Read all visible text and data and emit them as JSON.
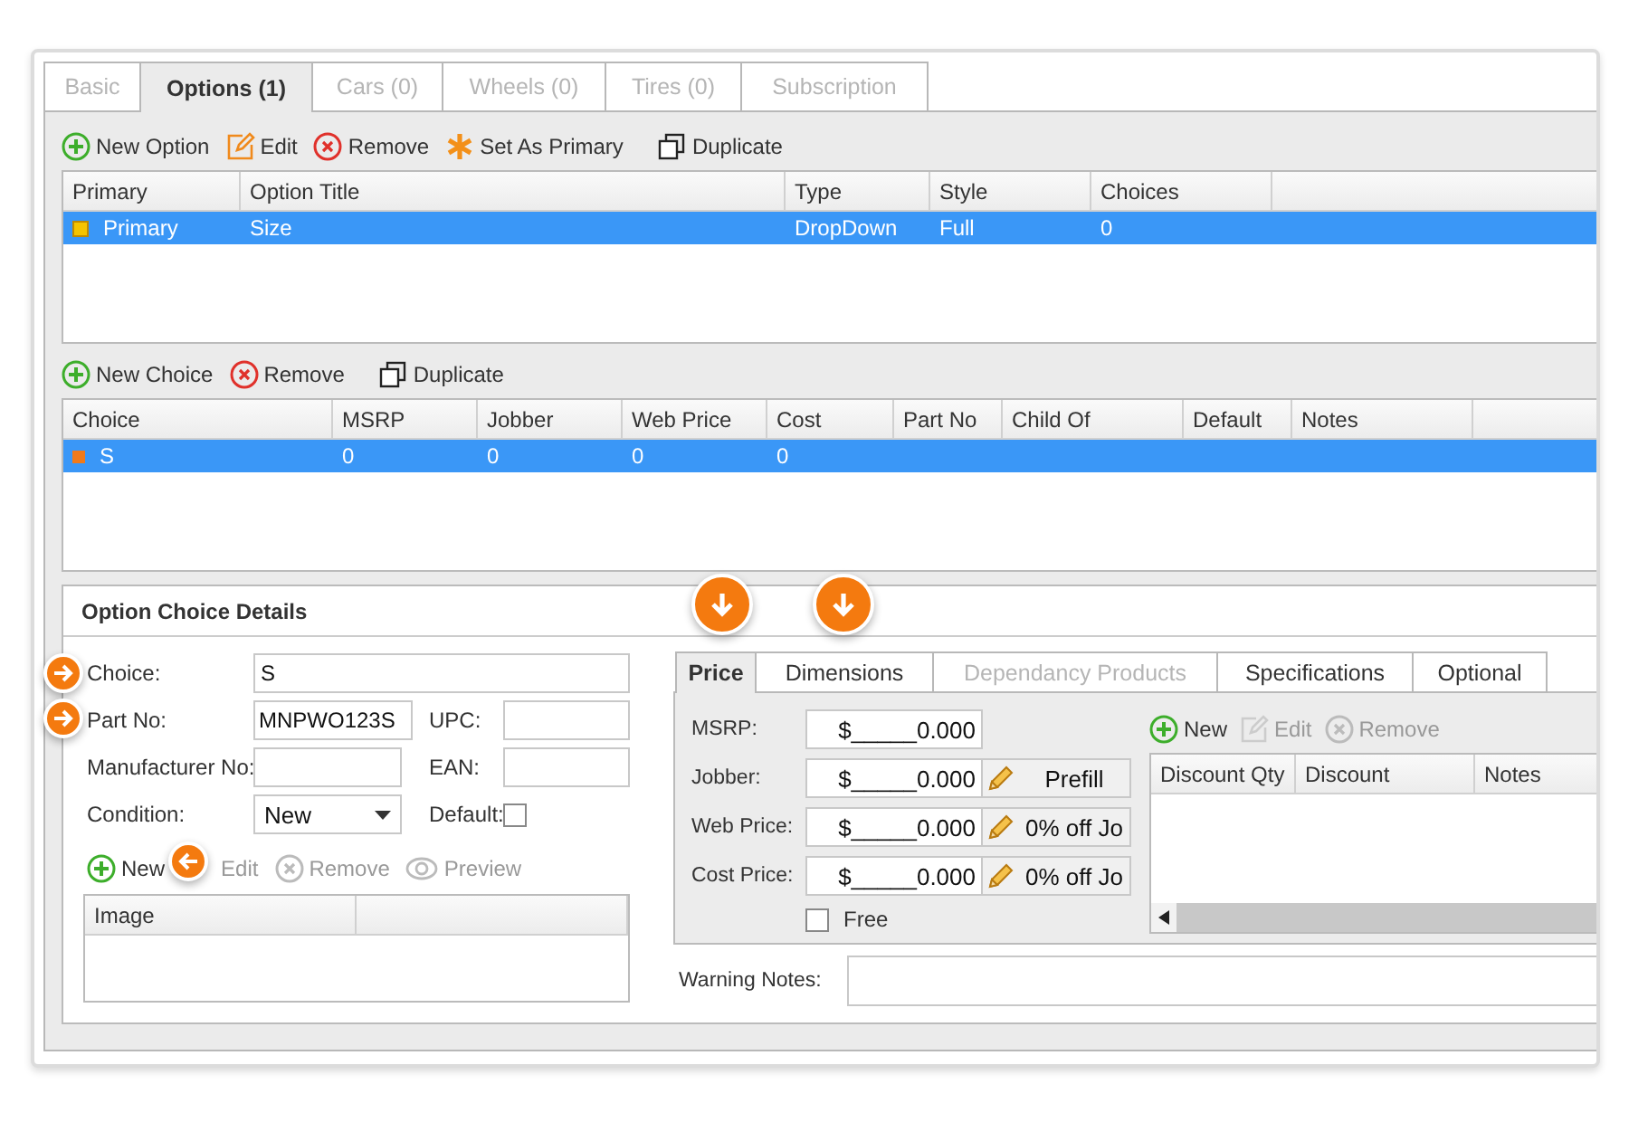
{
  "tabs": [
    {
      "label": "Basic",
      "selected": false,
      "disabled": true
    },
    {
      "label": "Options (1)",
      "selected": true,
      "disabled": false
    },
    {
      "label": "Cars (0)",
      "selected": false,
      "disabled": true
    },
    {
      "label": "Wheels (0)",
      "selected": false,
      "disabled": true
    },
    {
      "label": "Tires (0)",
      "selected": false,
      "disabled": true
    },
    {
      "label": "Subscription",
      "selected": false,
      "disabled": true
    }
  ],
  "option_toolbar": [
    {
      "label": "New Option",
      "kind": "add",
      "disabled": false
    },
    {
      "label": "Edit",
      "kind": "edit",
      "disabled": false
    },
    {
      "label": "Remove",
      "kind": "remove",
      "disabled": false
    },
    {
      "label": "Set As Primary",
      "kind": "star",
      "disabled": false
    },
    {
      "label": "Duplicate",
      "kind": "duplicate",
      "disabled": false
    }
  ],
  "options_table": {
    "columns": [
      "Primary",
      "Option Title",
      "Type",
      "Style",
      "Choices"
    ],
    "rows": [
      {
        "cells": [
          "Primary",
          "Size",
          "DropDown",
          "Full",
          "0"
        ],
        "selected": true
      }
    ]
  },
  "choice_toolbar": [
    {
      "label": "New Choice",
      "kind": "add",
      "disabled": false
    },
    {
      "label": "Remove",
      "kind": "remove",
      "disabled": false
    },
    {
      "label": "Duplicate",
      "kind": "duplicate",
      "disabled": false
    }
  ],
  "choices_table": {
    "columns": [
      "Choice",
      "MSRP",
      "Jobber",
      "Web Price",
      "Cost",
      "Part No",
      "Child Of",
      "Default",
      "Notes"
    ],
    "rows": [
      {
        "cells": [
          "S",
          "0",
          "0",
          "0",
          "0"
        ],
        "selected": true
      }
    ]
  },
  "details": {
    "title": "Option Choice Details",
    "choice": {
      "label": "Choice:",
      "value": "S"
    },
    "part_no": {
      "label": "Part No:",
      "value": "MNPWO123S"
    },
    "upc": {
      "label": "UPC:"
    },
    "manufacturer_no": {
      "label": "Manufacturer No:"
    },
    "ean": {
      "label": "EAN:"
    },
    "condition": {
      "label": "Condition:",
      "value": "New"
    },
    "default": {
      "label": "Default:",
      "checked": false
    },
    "image_toolbar": [
      {
        "label": "New",
        "kind": "add",
        "disabled": false
      },
      {
        "label": "Edit",
        "kind": "edit",
        "disabled": true
      },
      {
        "label": "Remove",
        "kind": "remove",
        "disabled": true
      },
      {
        "label": "Preview",
        "kind": "preview",
        "disabled": true
      }
    ],
    "image_table": {
      "columns": [
        "Image"
      ]
    },
    "detail_tabs": [
      {
        "label": "Price",
        "selected": true,
        "disabled": false
      },
      {
        "label": "Dimensions",
        "selected": false,
        "disabled": false
      },
      {
        "label": "Dependancy Products",
        "selected": false,
        "disabled": true
      },
      {
        "label": "Specifications",
        "selected": false,
        "disabled": false
      },
      {
        "label": "Optional",
        "selected": false,
        "disabled": false
      }
    ],
    "prices": [
      {
        "label": "MSRP:",
        "value": "$_____0.000"
      },
      {
        "label": "Jobber:",
        "value": "$_____0.000",
        "button": "Prefill"
      },
      {
        "label": "Web Price:",
        "value": "$_____0.000",
        "button": "0% off Jo"
      },
      {
        "label": "Cost Price:",
        "value": "$_____0.000",
        "button": "0% off Jo"
      }
    ],
    "free": {
      "label": "Free",
      "checked": false
    },
    "discount_toolbar": [
      {
        "label": "New",
        "kind": "add",
        "disabled": false
      },
      {
        "label": "Edit",
        "kind": "edit",
        "disabled": true
      },
      {
        "label": "Remove",
        "kind": "remove",
        "disabled": true
      }
    ],
    "discount_table": {
      "columns": [
        "Discount Qty",
        "Discount",
        "Notes"
      ]
    },
    "warning_notes": {
      "label": "Warning Notes:"
    }
  }
}
